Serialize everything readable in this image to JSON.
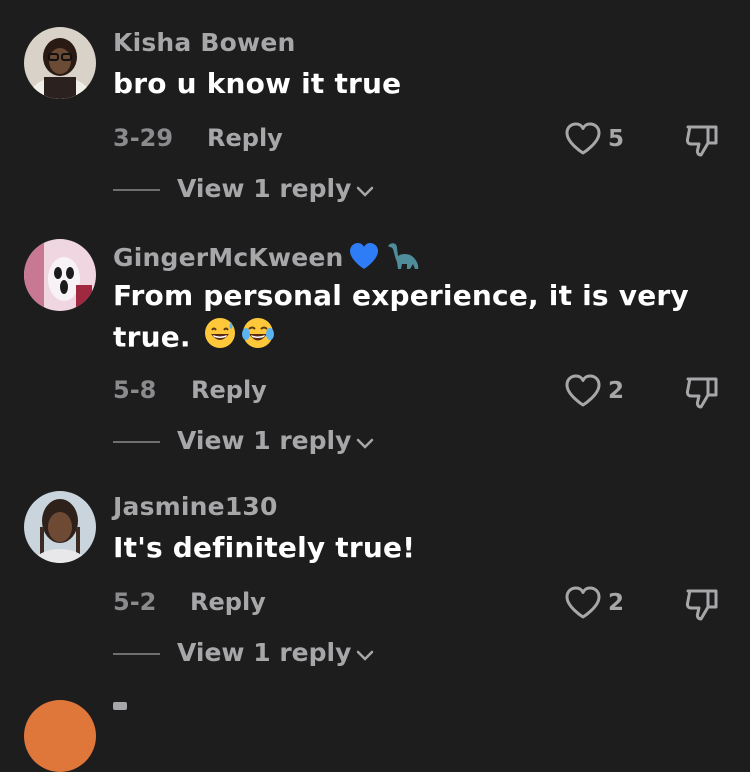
{
  "comments": [
    {
      "username": "Kisha Bowen",
      "text": "bro u know it true",
      "date": "3-29",
      "reply_label": "Reply",
      "likes": "5",
      "view_replies": "View 1 reply"
    },
    {
      "username": "GingerMcKween",
      "username_emojis": [
        "blue-heart-icon",
        "sauropod-icon"
      ],
      "text_line1": "From personal experience, it is very",
      "text_line2": "true.",
      "text_emojis": [
        "grinning-sweat-icon",
        "tears-of-joy-icon"
      ],
      "date": "5-8",
      "reply_label": "Reply",
      "likes": "2",
      "view_replies": "View 1 reply"
    },
    {
      "username": "Jasmine130",
      "text": "It's definitely true!",
      "date": "5-2",
      "reply_label": "Reply",
      "likes": "2",
      "view_replies": "View 1 reply"
    }
  ],
  "colors": {
    "background": "#1d1d1e",
    "username": "#a7a7a9",
    "text": "#ffffff",
    "meta": "#8b8b8e"
  }
}
